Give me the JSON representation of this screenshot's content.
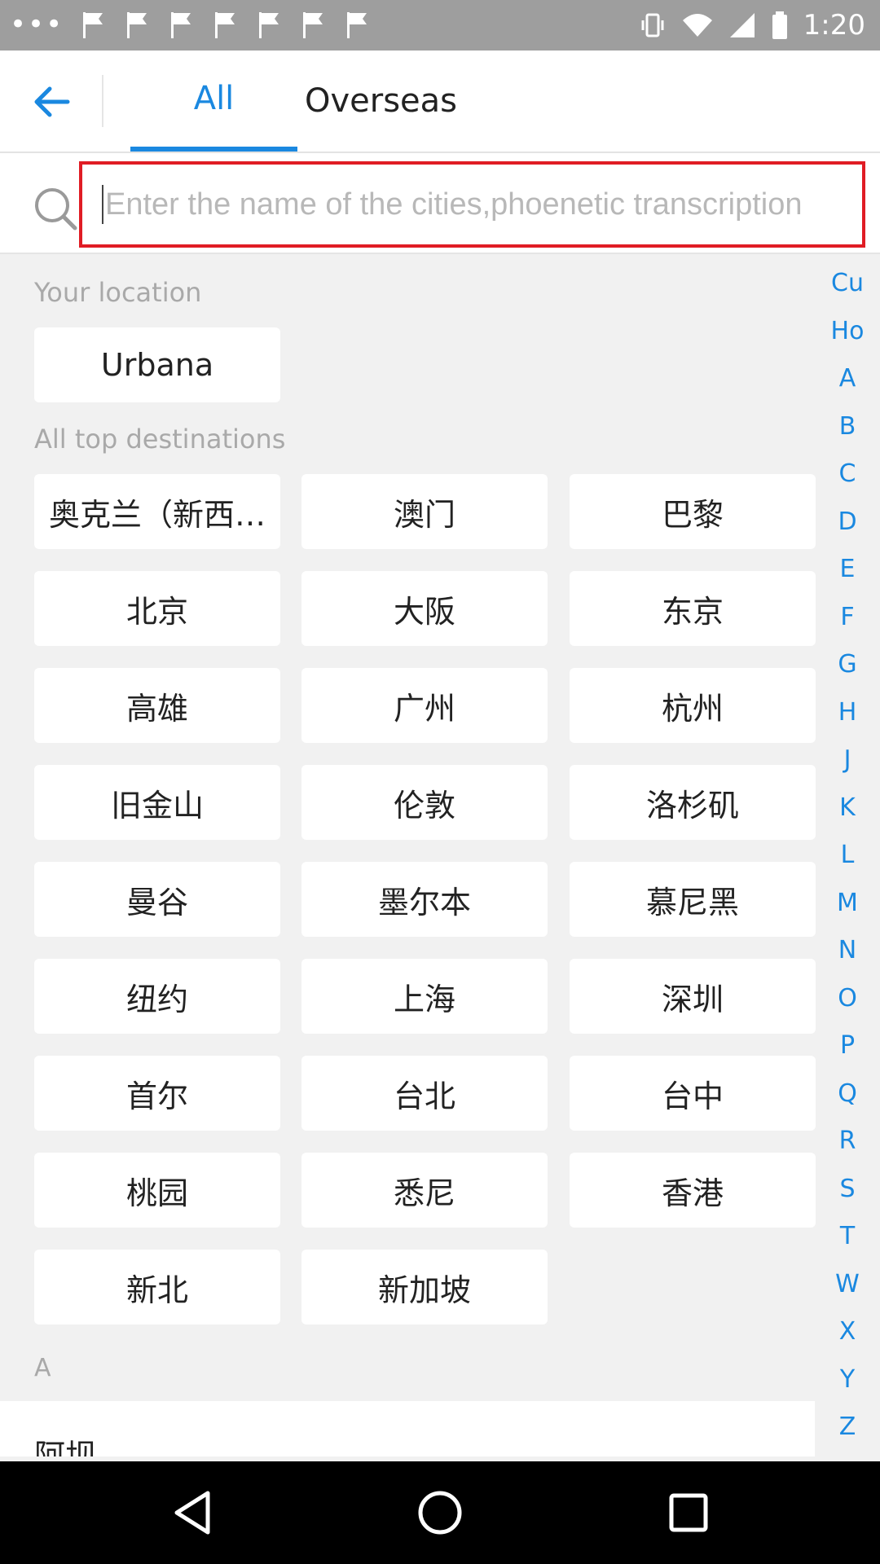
{
  "status_bar": {
    "time": "1:20",
    "icons": [
      "more-dots-icon",
      "flag-icon",
      "flag-icon",
      "flag-icon",
      "flag-icon",
      "flag-icon",
      "flag-icon",
      "flag-icon",
      "vibrate-icon",
      "wifi-icon",
      "signal-icon",
      "battery-icon"
    ],
    "more_dots": "•••"
  },
  "header": {
    "tabs": [
      {
        "label": "All",
        "active": true
      },
      {
        "label": "Overseas",
        "active": false
      }
    ]
  },
  "search": {
    "placeholder": "Enter the name of the cities,phoenetic transcription",
    "value": ""
  },
  "location": {
    "label": "Your location",
    "city": "Urbana"
  },
  "top_destinations": {
    "label": "All top destinations",
    "cities": [
      "奥克兰（新西…",
      "澳门",
      "巴黎",
      "北京",
      "大阪",
      "东京",
      "高雄",
      "广州",
      "杭州",
      "旧金山",
      "伦敦",
      "洛杉矶",
      "曼谷",
      "墨尔本",
      "慕尼黑",
      "纽约",
      "上海",
      "深圳",
      "首尔",
      "台北",
      "台中",
      "桃园",
      "悉尼",
      "香港",
      "新北",
      "新加坡"
    ]
  },
  "section_a": {
    "header": "A",
    "items": [
      "阿坝"
    ]
  },
  "alphabet_index": [
    "Cu",
    "Ho",
    "A",
    "B",
    "C",
    "D",
    "E",
    "F",
    "G",
    "H",
    "J",
    "K",
    "L",
    "M",
    "N",
    "O",
    "P",
    "Q",
    "R",
    "S",
    "T",
    "W",
    "X",
    "Y",
    "Z"
  ],
  "colors": {
    "accent": "#1a88e0",
    "highlight_border": "#e01c24",
    "background": "#f1f1f1",
    "status_bar": "#9e9e9e"
  }
}
